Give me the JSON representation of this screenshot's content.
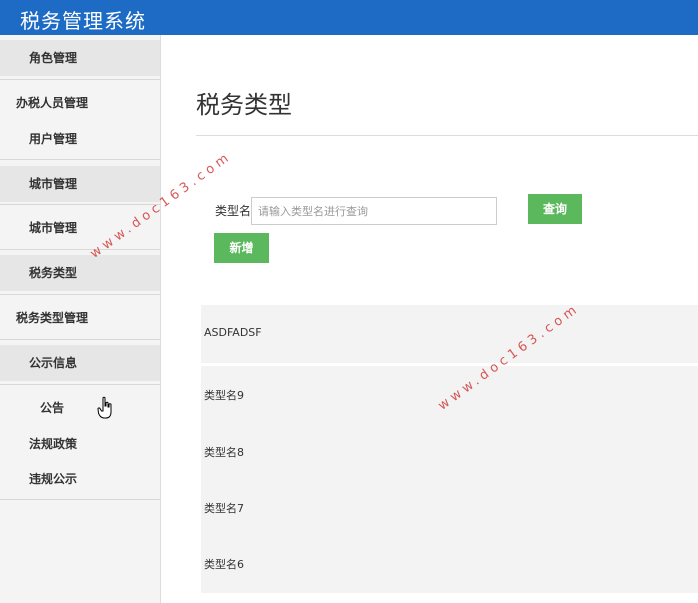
{
  "app": {
    "title": "税务管理系统"
  },
  "sidebar": {
    "items": [
      {
        "label": "角色管理"
      },
      {
        "label": "办税人员管理"
      },
      {
        "label": "用户管理"
      },
      {
        "label": "城市管理"
      },
      {
        "label": "城市管理"
      },
      {
        "label": "税务类型"
      },
      {
        "label": "税务类型管理"
      },
      {
        "label": "公示信息"
      },
      {
        "label": "公告"
      },
      {
        "label": "法规政策"
      },
      {
        "label": "违规公示"
      }
    ]
  },
  "main": {
    "page_title": "税务类型",
    "filter": {
      "label": "类型名",
      "placeholder": "请输入类型名进行查询"
    },
    "buttons": {
      "query": "查询",
      "add": "新增"
    },
    "rows": [
      "ASDFADSF",
      "类型名9",
      "类型名8",
      "类型名7",
      "类型名6"
    ]
  },
  "watermark": {
    "text": "www.doc163.com"
  }
}
